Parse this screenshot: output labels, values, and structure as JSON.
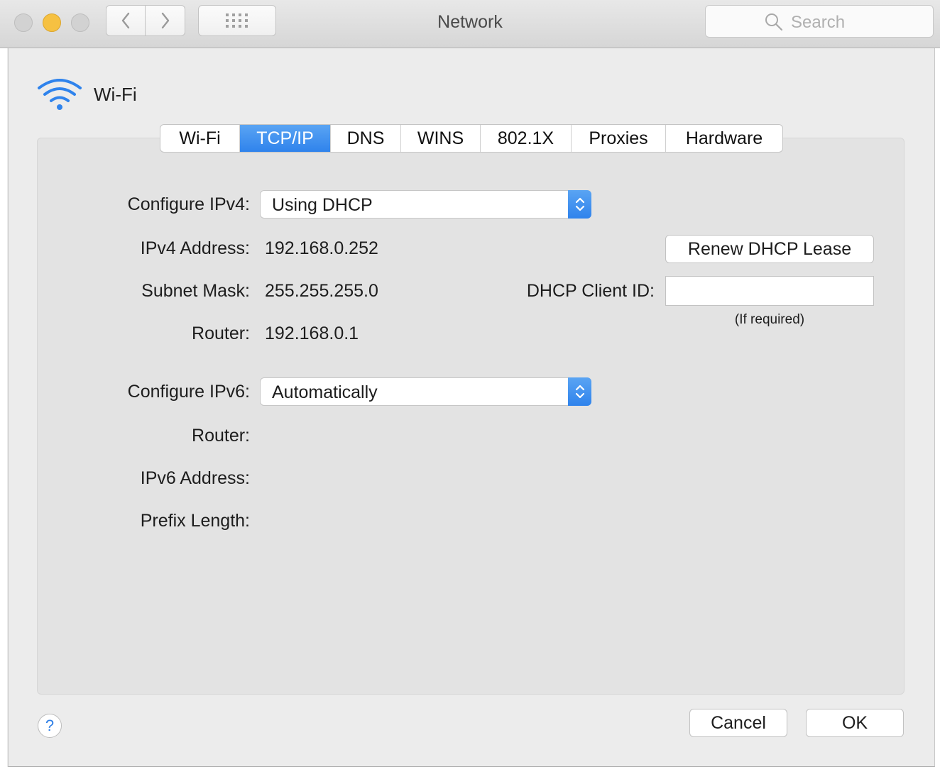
{
  "window": {
    "title": "Network",
    "search_placeholder": "Search"
  },
  "interface": {
    "name": "Wi-Fi",
    "accent": "#2f83ec"
  },
  "tabs": [
    {
      "label": "Wi-Fi",
      "active": false
    },
    {
      "label": "TCP/IP",
      "active": true
    },
    {
      "label": "DNS",
      "active": false
    },
    {
      "label": "WINS",
      "active": false
    },
    {
      "label": "802.1X",
      "active": false
    },
    {
      "label": "Proxies",
      "active": false
    },
    {
      "label": "Hardware",
      "active": false
    }
  ],
  "ipv4": {
    "configure_label": "Configure IPv4:",
    "configure_value": "Using DHCP",
    "address_label": "IPv4 Address:",
    "address_value": "192.168.0.252",
    "subnet_label": "Subnet Mask:",
    "subnet_value": "255.255.255.0",
    "router_label": "Router:",
    "router_value": "192.168.0.1"
  },
  "dhcp": {
    "renew_button": "Renew DHCP Lease",
    "client_id_label": "DHCP Client ID:",
    "client_id_value": "",
    "client_id_hint": "(If required)"
  },
  "ipv6": {
    "configure_label": "Configure IPv6:",
    "configure_value": "Automatically",
    "router_label": "Router:",
    "address_label": "IPv6 Address:",
    "prefix_label": "Prefix Length:"
  },
  "footer": {
    "help": "?",
    "cancel": "Cancel",
    "ok": "OK"
  }
}
